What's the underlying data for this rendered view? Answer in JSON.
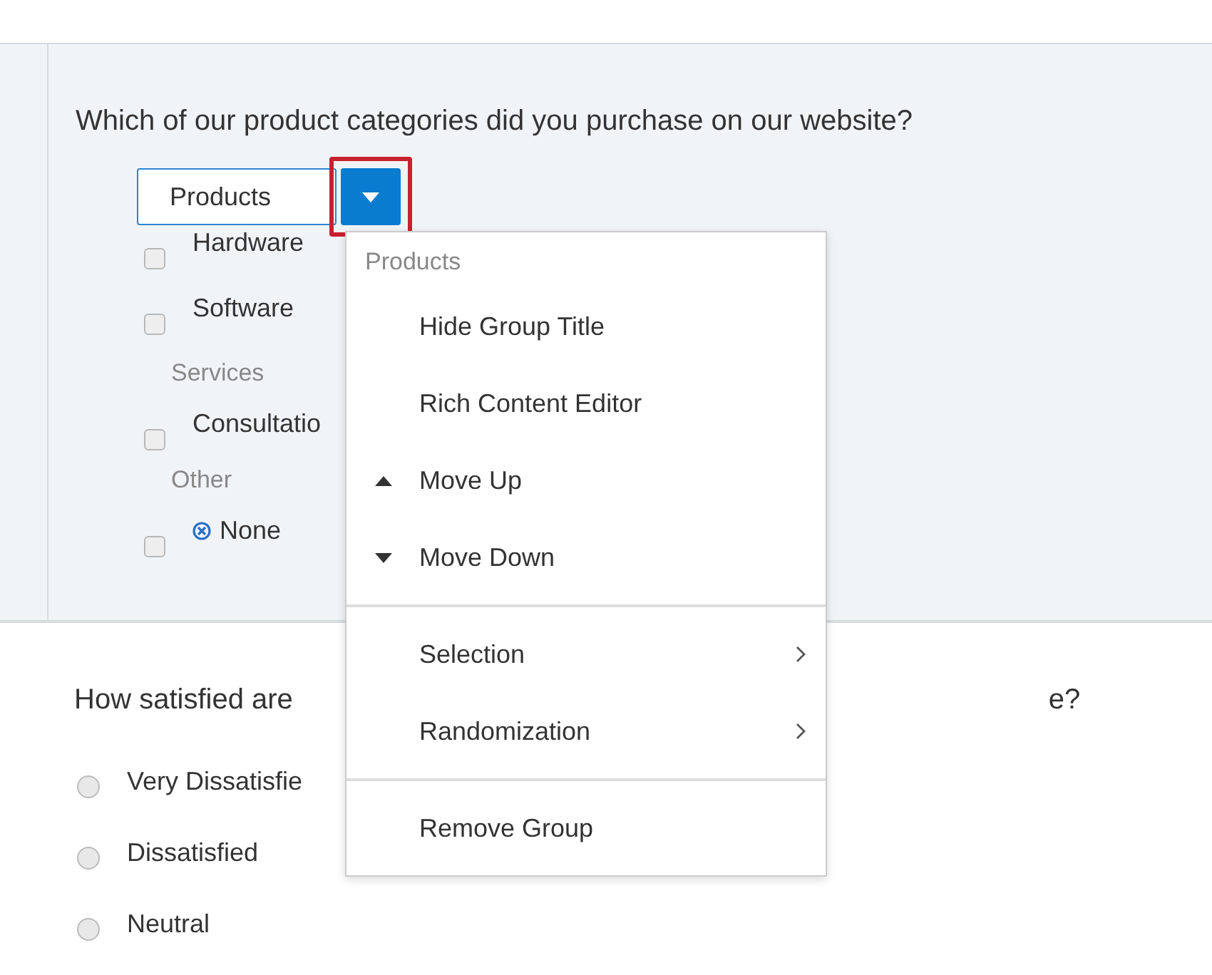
{
  "question_1": {
    "text": "Which of our product categories did you purchase on our website?",
    "group_select": {
      "value": "Products"
    },
    "choices": [
      {
        "kind": "option",
        "label": "Hardware",
        "checked": false
      },
      {
        "kind": "option",
        "label": "Software",
        "checked": false
      },
      {
        "kind": "group",
        "label": "Services"
      },
      {
        "kind": "option",
        "label": "Consultatio",
        "checked": false
      },
      {
        "kind": "group",
        "label": "Other"
      },
      {
        "kind": "exclusive",
        "label": "None",
        "checked": false
      }
    ]
  },
  "question_2": {
    "text_parts": [
      "How satisfied are",
      "e?"
    ],
    "choices": [
      {
        "label": "Very Dissatisfie",
        "selected": false
      },
      {
        "label": "Dissatisfied",
        "selected": false
      },
      {
        "label": "Neutral",
        "selected": false
      }
    ]
  },
  "menu": {
    "header": "Products",
    "sections": [
      [
        {
          "kind": "plain",
          "label": "Hide Group Title"
        },
        {
          "kind": "plain",
          "label": "Rich Content Editor"
        },
        {
          "kind": "move-up",
          "label": "Move Up"
        },
        {
          "kind": "move-down",
          "label": "Move Down"
        }
      ],
      [
        {
          "kind": "submenu",
          "label": "Selection"
        },
        {
          "kind": "submenu",
          "label": "Randomization"
        }
      ],
      [
        {
          "kind": "plain",
          "label": "Remove Group"
        }
      ]
    ]
  }
}
